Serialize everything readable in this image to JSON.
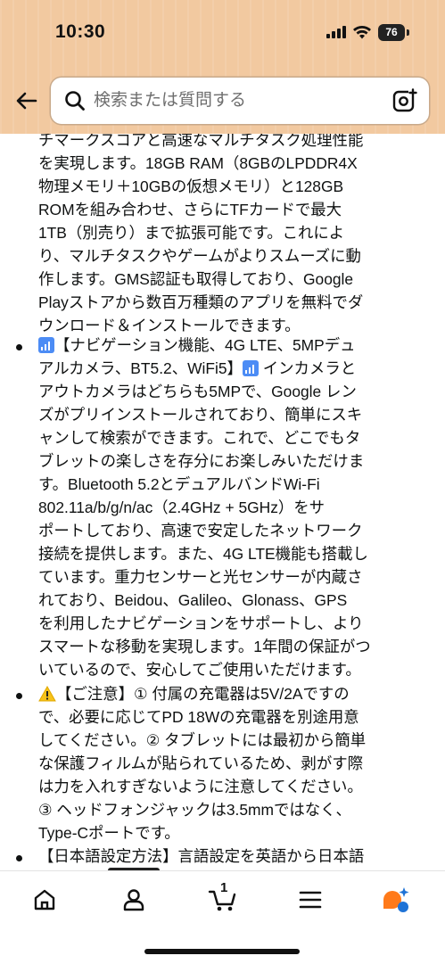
{
  "status_bar": {
    "time": "10:30",
    "battery": "76"
  },
  "header": {
    "back_icon": "back-arrow-icon",
    "search": {
      "placeholder": "検索または質問する",
      "value": ""
    },
    "camera_icon": "camera-search-icon",
    "background_color": "#f2c9a0"
  },
  "content": {
    "intro_lines": "チマークスコアと高速なマルチタスク処理性能\nを実現します。18GB RAM（8GBのLPDDR4X\n物理メモリ＋10GBの仮想メモリ）と128GB\nROMを組み合わせ、さらにTFカードで最大\n1TB（別売り）まで拡張可能です。これによ\nり、マルチタスクやゲームがよりスムーズに動\n作します。GMS認証も取得しており、Google\nPlayストアから数百万種類のアプリを無料でダ\nウンロード＆インストールできます。",
    "bullets": [
      {
        "head": "【ナビゲーション機能、4G LTE、5MPデュ\nアルカメラ、BT5.2、WiFi5】",
        "body": " インカメラと\nアウトカメラはどちらも5MPで、Google レン\nズがプリインストールされており、簡単にスキ\nャンして検索ができます。これで、どこでもタ\nブレットの楽しさを存分にお楽しみいただけま\nす。Bluetooth 5.2とデュアルバンドWi-Fi\n802.11a/b/g/n/ac（2.4GHz + 5GHz）をサ\nポートしており、高速で安定したネットワーク\n接続を提供します。また、4G LTE機能も搭載し\nています。重力センサーと光センサーが内蔵さ\nれており、Beidou、Galileo、Glonass、GPS\nを利用したナビゲーションをサポートし、より\nスマートな移動を実現します。1年間の保証がつ\nいているので、安心してご使用いただけます。"
      },
      {
        "head": "【ご注意】",
        "body": "① 付属の充電器は5V/2Aですの\nで、必要に応じてPD 18Wの充電器を別途用意\nしてください。② タブレットには最初から簡単\nな保護フィルムが貼られているため、剥がす際\nは力を入れすぎないように注意してください。\n③ ヘッドフォンジャックは3.5mmではなく、\nType-Cポートです。"
      },
      {
        "head": "【日本語設定方法】",
        "body": "言語設定を英語から日本語"
      }
    ]
  },
  "bottom_nav": {
    "items": [
      "home-icon",
      "account-icon",
      "cart-icon",
      "menu-icon",
      "rufus-assistant-icon"
    ],
    "cart_count": "1",
    "accent_color": "#ff7a1a",
    "assistant_secondary_color": "#1f73d6"
  }
}
